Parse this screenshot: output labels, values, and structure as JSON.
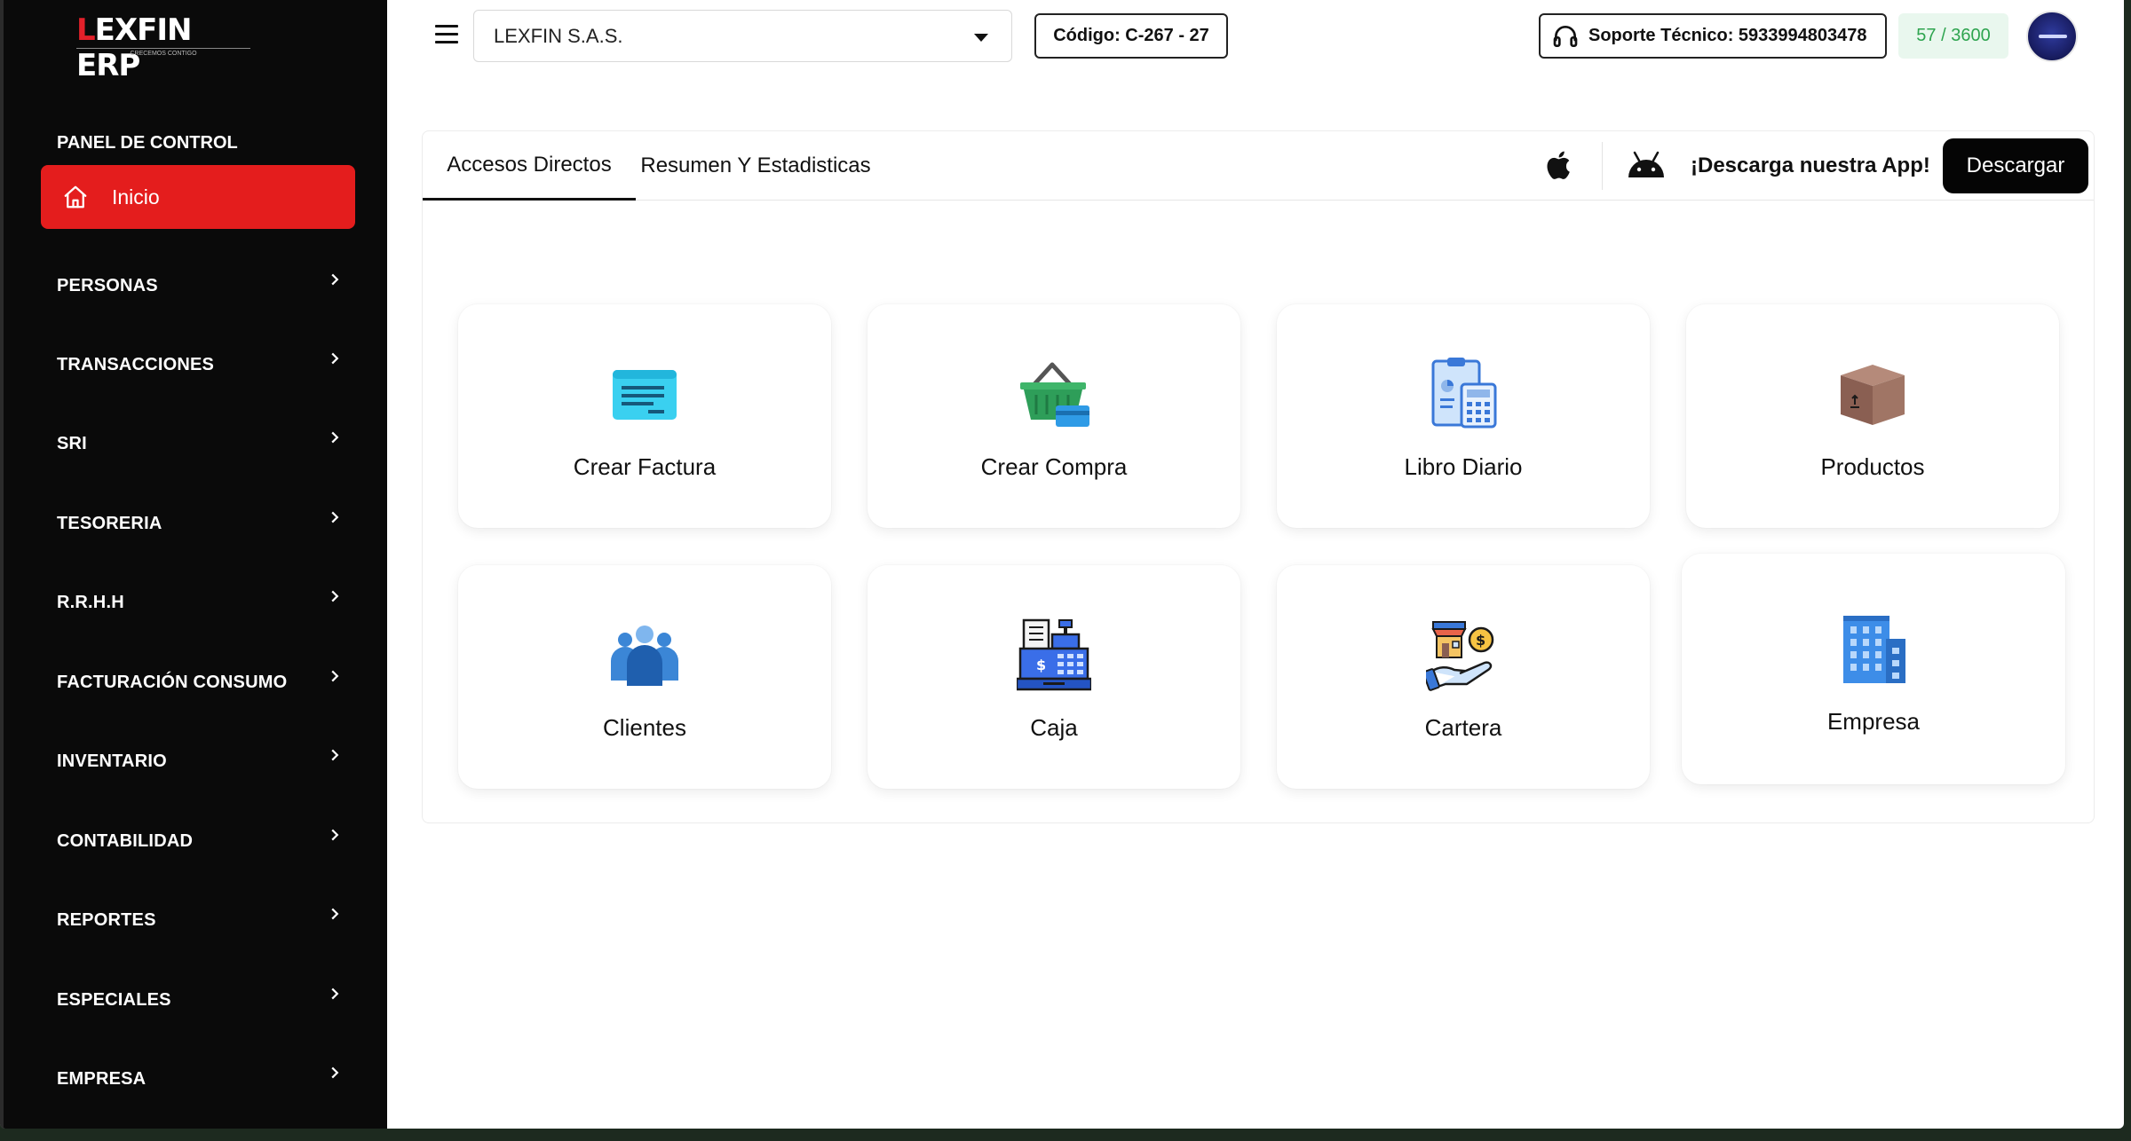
{
  "sidebar": {
    "logo_first": "L",
    "logo_rest": "EXFIN ERP",
    "logo_tagline": "CRECEMOS CONTIGO",
    "panel_label": "PANEL DE CONTROL",
    "home_label": "Inicio",
    "items": [
      {
        "label": "PERSONAS"
      },
      {
        "label": "TRANSACCIONES"
      },
      {
        "label": "SRI"
      },
      {
        "label": "TESORERIA"
      },
      {
        "label": "R.R.H.H"
      },
      {
        "label": "FACTURACIÓN CONSUMO"
      },
      {
        "label": "INVENTARIO"
      },
      {
        "label": "CONTABILIDAD"
      },
      {
        "label": "REPORTES"
      },
      {
        "label": "ESPECIALES"
      },
      {
        "label": "EMPRESA"
      }
    ]
  },
  "header": {
    "company_selected": "LEXFIN S.A.S.",
    "code": "Código: C-267 - 27",
    "support": "Soporte Técnico: 5933994803478",
    "count": "57 / 3600"
  },
  "tabs": [
    {
      "label": "Accesos Directos",
      "active": true
    },
    {
      "label": "Resumen Y Estadisticas",
      "active": false
    }
  ],
  "app_promo": {
    "text": "¡Descarga nuestra App!",
    "button": "Descargar"
  },
  "shortcuts": [
    {
      "label": "Crear Factura",
      "icon": "invoice-icon"
    },
    {
      "label": "Crear Compra",
      "icon": "basket-icon"
    },
    {
      "label": "Libro Diario",
      "icon": "clipboard-calculator-icon"
    },
    {
      "label": "Productos",
      "icon": "box-icon"
    },
    {
      "label": "Clientes",
      "icon": "people-icon"
    },
    {
      "label": "Caja",
      "icon": "cash-register-icon"
    },
    {
      "label": "Cartera",
      "icon": "store-coin-hand-icon"
    },
    {
      "label": "Empresa",
      "icon": "building-icon"
    }
  ],
  "colors": {
    "accent_red": "#e41d1d",
    "sidebar_bg": "#0a0a0a",
    "count_green": "#2ea44f"
  }
}
